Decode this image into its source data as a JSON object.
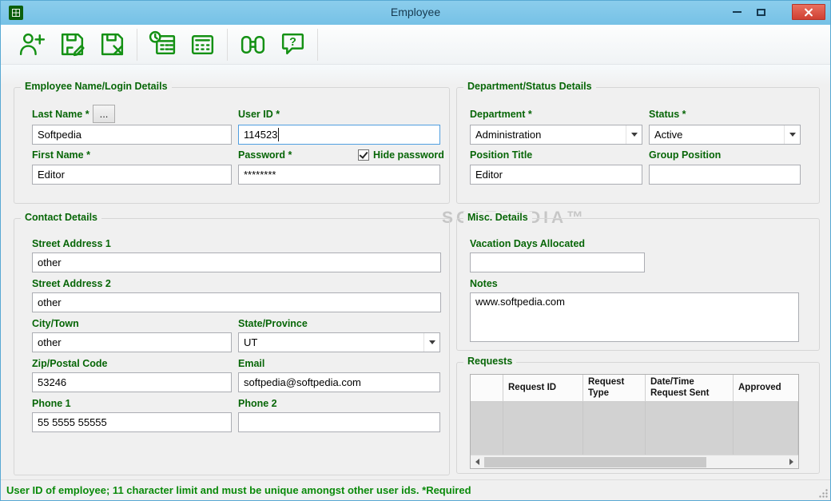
{
  "window": {
    "title": "Employee"
  },
  "toolbar": {
    "buttons": [
      {
        "name": "add-employee",
        "icon": "person-plus-icon"
      },
      {
        "name": "save-employee",
        "icon": "save-edit-icon"
      },
      {
        "name": "delete-employee",
        "icon": "save-delete-icon"
      },
      {
        "name": "schedule",
        "icon": "calendar-clock-icon"
      },
      {
        "name": "calculator",
        "icon": "calculator-icon"
      },
      {
        "name": "find",
        "icon": "binoculars-icon"
      },
      {
        "name": "help",
        "icon": "help-bubble-icon"
      }
    ]
  },
  "login_group": {
    "title": "Employee Name/Login Details",
    "last_name": {
      "label": "Last Name *",
      "value": "Softpedia",
      "browse": "..."
    },
    "user_id": {
      "label": "User ID *",
      "value": "114523"
    },
    "first_name": {
      "label": "First Name *",
      "value": "Editor"
    },
    "password": {
      "label": "Password *",
      "value": "********",
      "hide_label": "Hide password",
      "hide_checked": true
    }
  },
  "department_group": {
    "title": "Department/Status Details",
    "department": {
      "label": "Department *",
      "value": "Administration"
    },
    "status": {
      "label": "Status *",
      "value": "Active"
    },
    "position_title": {
      "label": "Position Title",
      "value": "Editor"
    },
    "group_position": {
      "label": "Group Position",
      "value": ""
    }
  },
  "contact_group": {
    "title": "Contact Details",
    "street1": {
      "label": "Street Address 1",
      "value": "other"
    },
    "street2": {
      "label": "Street Address 2",
      "value": "other"
    },
    "city": {
      "label": "City/Town",
      "value": "other"
    },
    "state": {
      "label": "State/Province",
      "value": "UT"
    },
    "zip": {
      "label": "Zip/Postal Code",
      "value": "53246"
    },
    "email": {
      "label": "Email",
      "value": "softpedia@softpedia.com"
    },
    "phone1": {
      "label": "Phone 1",
      "value": "55 5555 55555"
    },
    "phone2": {
      "label": "Phone 2",
      "value": ""
    }
  },
  "misc_group": {
    "title": "Misc. Details",
    "vacation": {
      "label": "Vacation Days Allocated",
      "value": ""
    },
    "notes": {
      "label": "Notes",
      "value": "www.softpedia.com"
    }
  },
  "requests_group": {
    "title": "Requests",
    "headers": [
      "",
      "Request ID",
      "Request Type",
      "Date/Time Request Sent",
      "Approved"
    ]
  },
  "status_bar": {
    "text": "User ID of employee; 11 character limit and must be unique amongst other user ids. *Required"
  },
  "watermark": "SOFTPEDIA™",
  "colors": {
    "label_green": "#076607",
    "status_green": "#0a8a0a",
    "icon_green": "#149114",
    "titlebar_blue": "#7ec6e9",
    "close_red": "#d9453a",
    "focus_blue": "#4f9ee0"
  }
}
